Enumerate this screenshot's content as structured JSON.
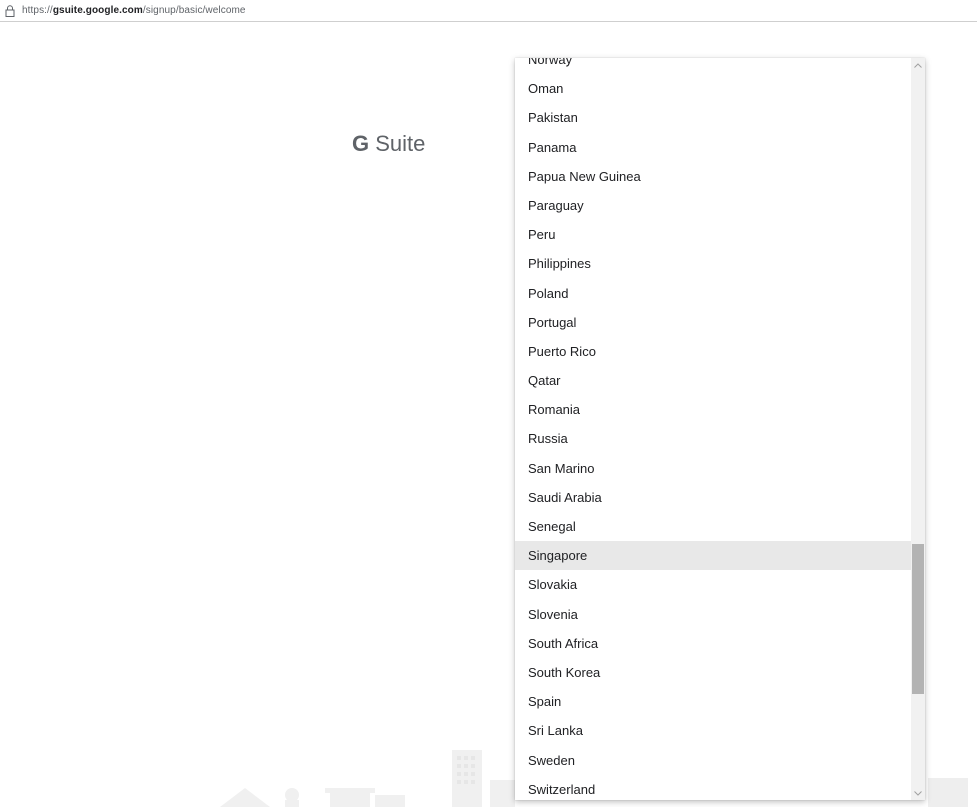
{
  "browser": {
    "url_prefix": "https://",
    "url_host": "gsuite.google.com",
    "url_path": "/signup/basic/welcome"
  },
  "logo": {
    "g": "G",
    "text": " Suite"
  },
  "dropdown": {
    "options": [
      "Norway",
      "Oman",
      "Pakistan",
      "Panama",
      "Papua New Guinea",
      "Paraguay",
      "Peru",
      "Philippines",
      "Poland",
      "Portugal",
      "Puerto Rico",
      "Qatar",
      "Romania",
      "Russia",
      "San Marino",
      "Saudi Arabia",
      "Senegal",
      "Singapore",
      "Slovakia",
      "Slovenia",
      "South Africa",
      "South Korea",
      "Spain",
      "Sri Lanka",
      "Sweden",
      "Switzerland"
    ],
    "selected": "Singapore"
  },
  "colors": {
    "highlight": "#e8e8e8",
    "text": "#202124",
    "scroll_thumb": "#b3b3b3"
  },
  "icons": {
    "lock": "lock-icon",
    "scroll_up": "chevron-up-icon",
    "scroll_down": "chevron-down-icon"
  }
}
